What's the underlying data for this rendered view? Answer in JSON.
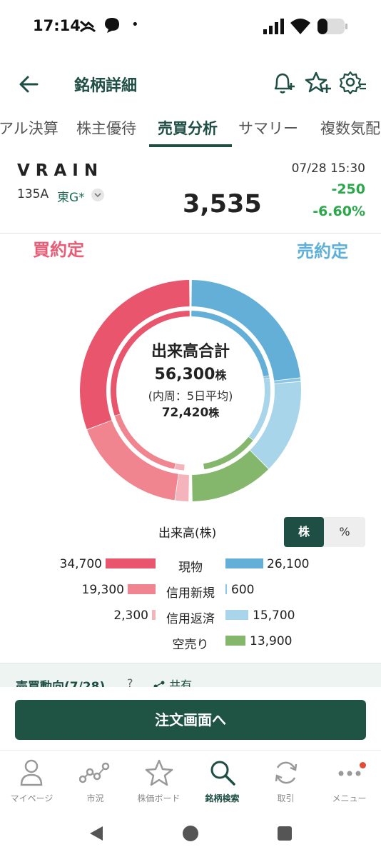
{
  "status_bar": {
    "time": "17:14",
    "dot": "•"
  },
  "header": {
    "title": "銘柄詳細"
  },
  "tabs": [
    {
      "label": "アル決算"
    },
    {
      "label": "株主優待"
    },
    {
      "label": "売買分析",
      "active": true
    },
    {
      "label": "サマリー"
    },
    {
      "label": "複数気配"
    }
  ],
  "stock": {
    "name": "VRAIN",
    "code": "135A",
    "market": "東G*",
    "datetime": "07/28 15:30",
    "price": "3,535",
    "change": "-250",
    "change_pct": "-6.60%"
  },
  "analysis": {
    "buy_label": "買約定",
    "sell_label": "売約定",
    "center_title": "出来高合計",
    "total_volume": "56,300",
    "unit": "株",
    "inner_note": "(内周：5日平均)",
    "avg_volume": "72,420",
    "volume_title": "出来高(株)",
    "toggle_shares": "株",
    "toggle_percent": "%"
  },
  "chart_data": {
    "type": "pie",
    "title": "出来高合計",
    "total": 56300,
    "unit": "株",
    "buy": [
      {
        "name": "現物",
        "value": 34700
      },
      {
        "name": "信用新規",
        "value": 19300
      },
      {
        "name": "信用返済",
        "value": 2300
      }
    ],
    "sell": [
      {
        "name": "現物",
        "value": 26100
      },
      {
        "name": "信用新規",
        "value": 600
      },
      {
        "name": "信用返済",
        "value": 15700
      },
      {
        "name": "空売り",
        "value": 13900
      }
    ],
    "colors": {
      "buy_cash": "#e8556d",
      "buy_margin_new": "#f0848f",
      "buy_margin_close": "#f5b3bb",
      "sell_cash": "#63afd7",
      "sell_margin_new": "#8cc6e5",
      "sell_margin_close": "#a8d5ea",
      "short": "#84b76b"
    }
  },
  "legend_rows": [
    {
      "left": "34,700",
      "label": "現物",
      "right": "26,100"
    },
    {
      "left": "19,300",
      "label": "信用新規",
      "right": "600"
    },
    {
      "left": "2,300",
      "label": "信用返済",
      "right": "15,700"
    },
    {
      "left": "",
      "label": "空売り",
      "right": "13,900"
    }
  ],
  "trend": {
    "title": "売買動向(7/28)",
    "help": "?",
    "share": "共有"
  },
  "order_button": "注文画面へ",
  "bottom_nav": [
    {
      "label": "マイページ",
      "icon": "person-icon"
    },
    {
      "label": "市況",
      "icon": "market-chart-icon"
    },
    {
      "label": "株価ボード",
      "icon": "star-icon"
    },
    {
      "label": "銘柄検索",
      "icon": "search-icon",
      "active": true
    },
    {
      "label": "取引",
      "icon": "refresh-icon"
    },
    {
      "label": "メニュー",
      "icon": "menu-dots-icon"
    }
  ]
}
